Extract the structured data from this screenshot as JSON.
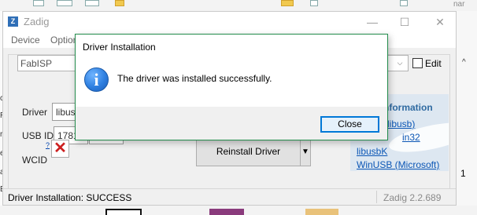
{
  "window": {
    "title": "Zadig",
    "minimize_glyph": "—",
    "maximize_glyph": "☐",
    "close_glyph": "✕"
  },
  "menu": {
    "device": "Device",
    "options": "Option"
  },
  "device_select": {
    "value": "FabISP",
    "arrow_glyph": "⌵"
  },
  "edit": {
    "label": "Edit",
    "checked": false
  },
  "fields": {
    "driver_label": "Driver",
    "driver_value": "libusb",
    "usbid_label": "USB ID",
    "usbid_value": "1781",
    "wcid_label": "WCID",
    "wcid_help": "?",
    "wcid_status_glyph": "✕"
  },
  "action": {
    "reinstall_label": "Reinstall Driver",
    "split_arrow_glyph": "▼"
  },
  "info": {
    "title": "nformation",
    "links": [
      "(libusb)",
      "in32",
      "libusbK",
      "WinUSB (Microsoft)"
    ]
  },
  "status": {
    "text": "Driver Installation: SUCCESS",
    "version": "Zadig 2.2.689"
  },
  "dialog": {
    "title": "Driver Installation",
    "message": "The driver was installed successfully.",
    "close_label": "Close",
    "icon_glyph": "i"
  },
  "background": {
    "top_label": "nar",
    "right_digit": "1",
    "right_chevron": "^"
  },
  "colors": {
    "dialog_border": "#238c4c",
    "link": "#0b56b5",
    "info_title": "#2f6aa1",
    "wcid_x": "#cc1f1f",
    "info_panel": "#dde7f1",
    "close_button_border": "#0078d7"
  }
}
